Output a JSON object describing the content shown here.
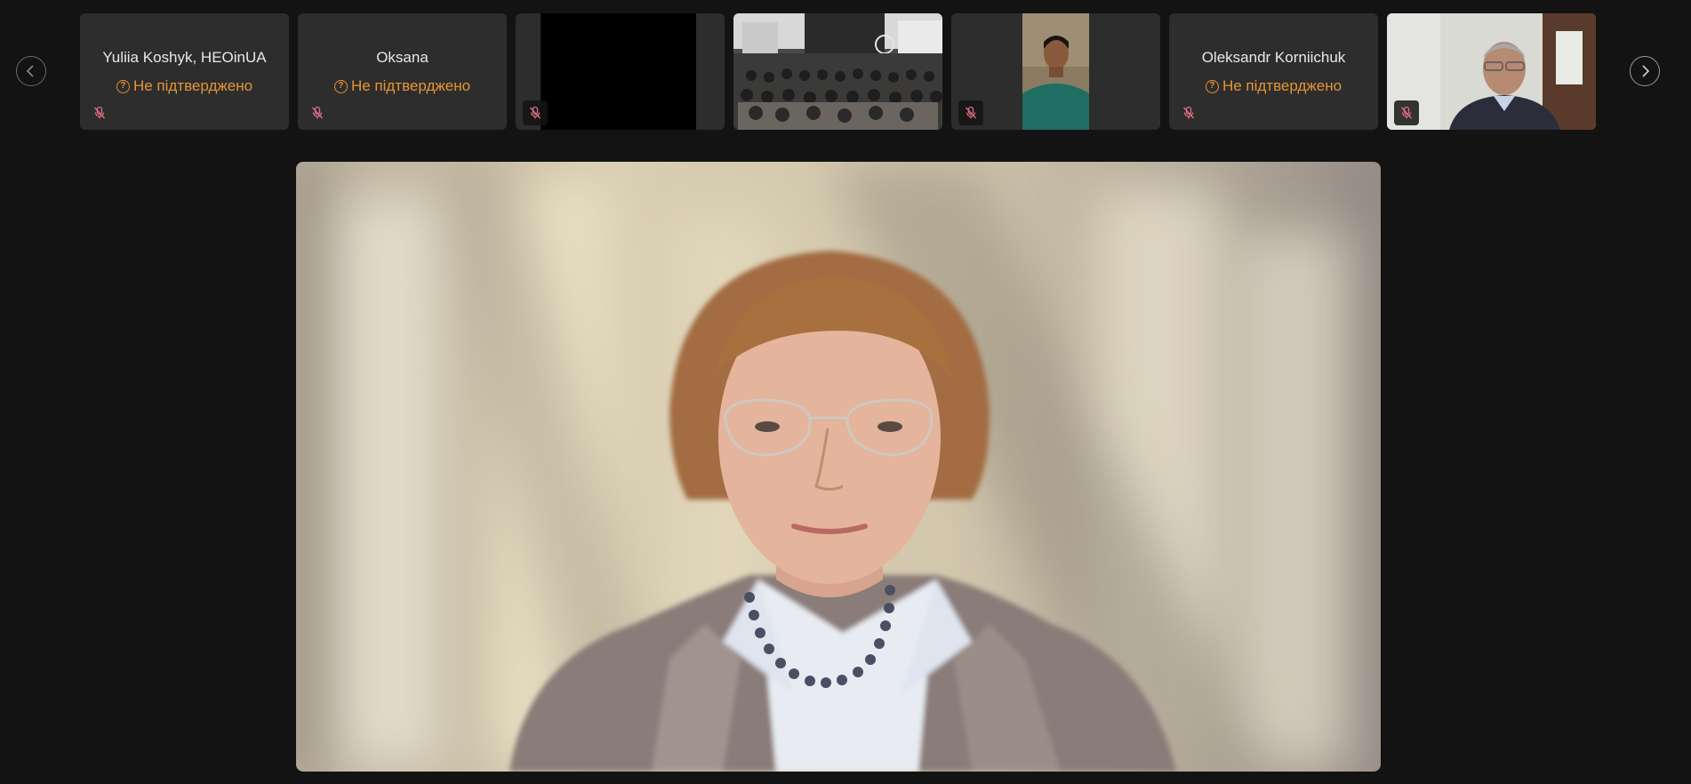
{
  "navigation": {
    "prev_icon": "chevron-left-icon",
    "next_icon": "chevron-right-icon"
  },
  "participants": [
    {
      "name": "Yuliia Koshyk, HEOinUA",
      "status": "Не підтверджено",
      "muted": true
    },
    {
      "name": "Oksana",
      "status": "Не підтверджено",
      "muted": true
    },
    {
      "name": "",
      "video": "black",
      "muted": true
    },
    {
      "name": "",
      "video": "conference-room",
      "muted": false
    },
    {
      "name": "",
      "video": "person-webcam",
      "muted": true
    },
    {
      "name": "Oleksandr Korniichuk",
      "status": "Не підтверджено",
      "muted": true
    },
    {
      "name": "",
      "video": "person-webcam",
      "muted": true
    }
  ],
  "main_speaker": {
    "video": "speaker-webcam"
  },
  "colors": {
    "background": "#131313",
    "tile": "#2d2d2d",
    "status": "#e69533",
    "muted_icon": "#e06c83"
  }
}
